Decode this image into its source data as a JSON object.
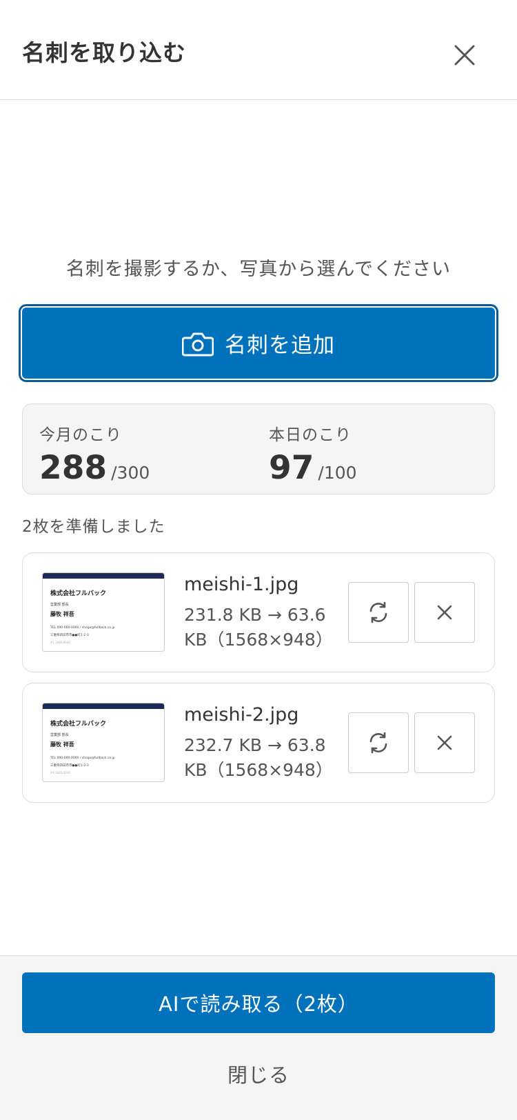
{
  "header": {
    "title": "名刺を取り込む",
    "close_icon": "close-icon"
  },
  "instruction": "名刺を撮影するか、写真から選んでください",
  "add_button": {
    "icon": "camera-icon",
    "label": "名刺を追加",
    "color": "#0071bb"
  },
  "quota": {
    "monthly": {
      "label": "今月のこり",
      "value": "288",
      "limit": "/300"
    },
    "daily": {
      "label": "本日のこり",
      "value": "97",
      "limit": "/100"
    }
  },
  "ready_text": "2枚を準備しました",
  "files": [
    {
      "name": "meishi-1.jpg",
      "size_line1": "231.8 KB → 63.6",
      "size_line2": "KB（1568×948）",
      "refresh_icon": "refresh-icon",
      "remove_icon": "close-icon",
      "thumbnail": {
        "company": "株式会社フルバック",
        "dept": "営業部 部長",
        "person": "藤牧 祥吾",
        "contact": "TEL 090-000-0000 / shogo@fullback.co.jp",
        "address": "三重県四日市市●●町1-2-3",
        "extra": "#1 2045/2030"
      }
    },
    {
      "name": "meishi-2.jpg",
      "size_line1": "232.7 KB → 63.8",
      "size_line2": "KB（1568×948）",
      "refresh_icon": "refresh-icon",
      "remove_icon": "close-icon",
      "thumbnail": {
        "company": "株式会社フルバック",
        "dept": "営業部 部長",
        "person": "藤牧 祥吾",
        "contact": "TEL 090-000-0000 / shogo@fullback.co.jp",
        "address": "三重県四日市市●●町1-2-3",
        "extra": "#1 2045/2030"
      }
    }
  ],
  "footer": {
    "ai_button_label": "AIで読み取る（2枚）",
    "close_label": "閉じる"
  }
}
